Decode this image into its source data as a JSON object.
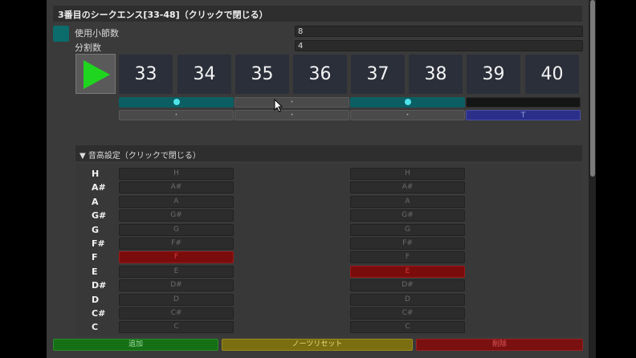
{
  "header": {
    "title": "3番目のシークエンス[33-48]（クリックで閉じる）"
  },
  "settings": {
    "bars_label": "使用小節数",
    "bars_value": "8",
    "divisions_label": "分割数",
    "divisions_value": "4"
  },
  "colors": {
    "swatch": "#0c6b6b",
    "teal": "#0b5f62",
    "active_note": "#7a0c0c"
  },
  "play_icon": "play-icon",
  "measures": [
    "33",
    "34",
    "35",
    "36",
    "37",
    "38",
    "39",
    "40"
  ],
  "row1": [
    {
      "style": "teal",
      "dot": true,
      "text": ""
    },
    {
      "style": "gray",
      "dot": false,
      "text": "・"
    },
    {
      "style": "teal",
      "dot": true,
      "text": ""
    },
    {
      "style": "black",
      "dot": false,
      "text": ""
    }
  ],
  "row2": [
    {
      "style": "gray",
      "text": "・"
    },
    {
      "style": "gray",
      "text": "・"
    },
    {
      "style": "gray",
      "text": "・"
    },
    {
      "style": "purple",
      "text": "T"
    }
  ],
  "pitch": {
    "header": "▼ 音高設定（クリックで閉じる）",
    "notes": [
      "H",
      "A#",
      "A",
      "G#",
      "G",
      "F#",
      "F",
      "E",
      "D#",
      "D",
      "C#",
      "C"
    ],
    "left_active": "F",
    "right_active": "E"
  },
  "buttons": {
    "add": "追加",
    "reset": "ノーツリセット",
    "delete": "削除"
  }
}
